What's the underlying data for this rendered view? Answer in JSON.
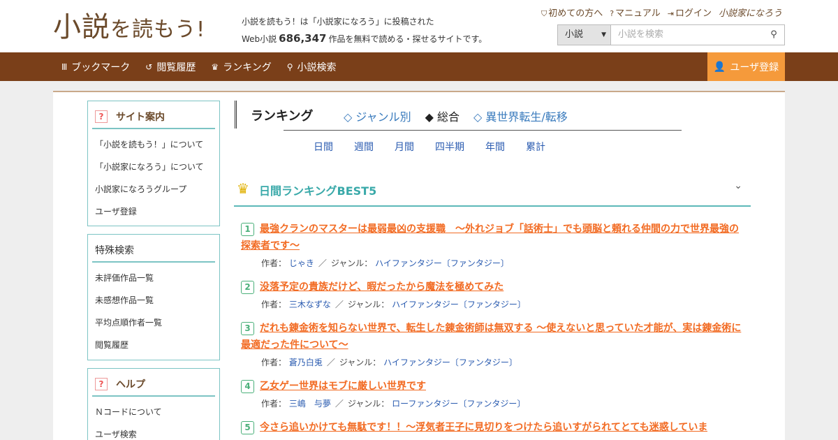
{
  "header": {
    "logo_main": "小説",
    "logo_small": "を読もう!",
    "tagline_line1": "小説を読もう！は「小説家になろう」に投稿された",
    "tagline_prefix": "Web小説",
    "tagline_count": "686,347",
    "tagline_suffix": "作品を無料で読める・探せるサイトです。",
    "links": {
      "first_time": "初めての方へ",
      "manual": "マニュアル",
      "login": "ログイン",
      "narou_logo": "小説家になろう"
    },
    "search": {
      "select_value": "小説",
      "placeholder": "小説を検索"
    }
  },
  "nav": {
    "items": [
      {
        "label": "ブックマーク",
        "icon": "bookmark-icon"
      },
      {
        "label": "閲覧履歴",
        "icon": "history-icon"
      },
      {
        "label": "ランキング",
        "icon": "crown-icon"
      },
      {
        "label": "小説検索",
        "icon": "search-icon"
      }
    ],
    "register": "ユーザ登録"
  },
  "sidebar": {
    "site_guide": {
      "title": "サイト案内",
      "items": [
        "「小説を読もう！」について",
        "「小説家になろう」について",
        "小説家になろうグループ",
        "ユーザ登録"
      ]
    },
    "special_search": {
      "title": "特殊検索",
      "items": [
        "未評価作品一覧",
        "未感想作品一覧",
        "平均点順作者一覧",
        "閲覧履歴"
      ]
    },
    "help": {
      "title": "ヘルプ",
      "items": [
        "Ｎコードについて",
        "ユーザ検索"
      ]
    }
  },
  "ranking": {
    "title": "ランキング",
    "tabs": [
      {
        "label": "◇ ジャンル別",
        "active": false
      },
      {
        "label": "◆ 総合",
        "active": true
      },
      {
        "label": "◇ 異世界転生/転移",
        "active": false
      }
    ],
    "periods": [
      "日間",
      "週間",
      "月間",
      "四半期",
      "年間",
      "累計"
    ],
    "best_title": "日間ランキングBEST5",
    "author_label": "作者：",
    "genre_label": "ジャンル：",
    "items": [
      {
        "rank": "1",
        "title": "最強クランのマスターは最弱最凶の支援職　～外れジョブ「話術士」でも頭脳と頼れる仲間の力で世界最強の探索者です～",
        "author": "じゃき",
        "genre": "ハイファンタジー〔ファンタジー〕"
      },
      {
        "rank": "2",
        "title": "没落予定の貴族だけど、暇だったから魔法を極めてみた",
        "author": "三木なずな",
        "genre": "ハイファンタジー〔ファンタジー〕"
      },
      {
        "rank": "3",
        "title": "だれも錬金術を知らない世界で、転生した錬金術師は無双する 〜使えないと思っていた才能が、実は錬金術に最適だった件について〜",
        "author": "蒼乃白兎",
        "genre": "ハイファンタジー〔ファンタジー〕"
      },
      {
        "rank": "4",
        "title": "乙女ゲー世界はモブに厳しい世界です",
        "author": "三嶋　与夢",
        "genre": "ローファンタジー〔ファンタジー〕"
      },
      {
        "rank": "5",
        "title": "今さら追いかけても無駄です！！～浮気者王子に見切りをつけたら追いすがられてとても迷惑していま",
        "author": "",
        "genre": ""
      }
    ]
  }
}
